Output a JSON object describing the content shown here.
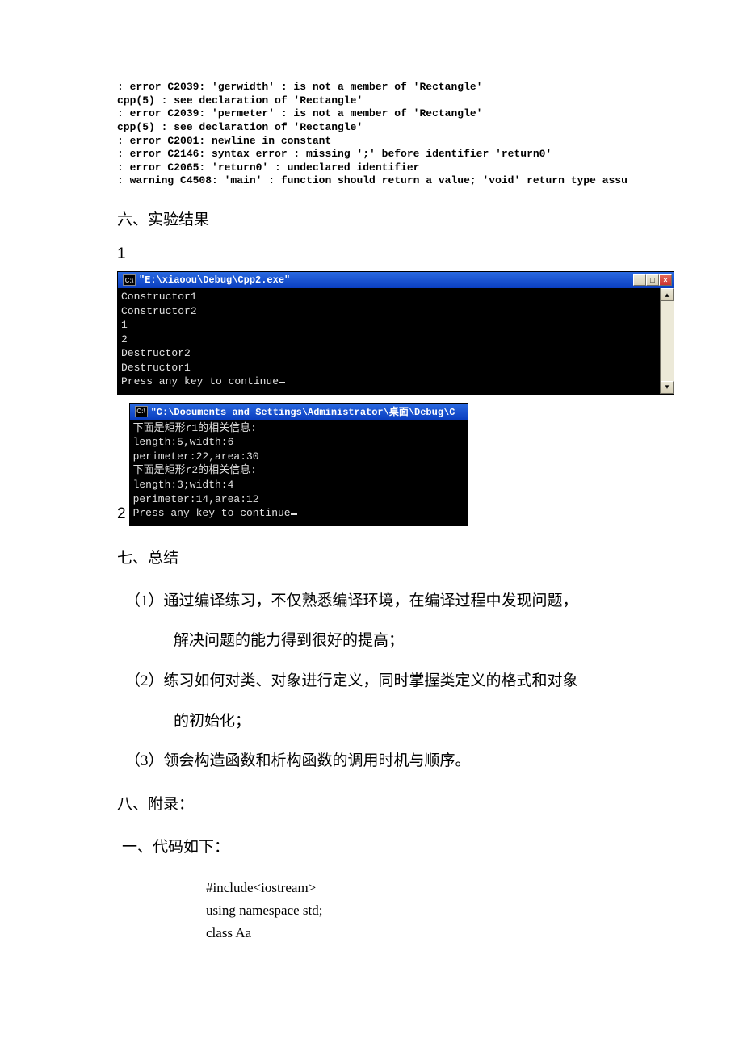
{
  "compiler_errors": [
    ": error C2039: 'gerwidth' : is not a member of 'Rectangle'",
    "cpp(5) : see declaration of 'Rectangle'",
    ": error C2039: 'permeter' : is not a member of 'Rectangle'",
    "cpp(5) : see declaration of 'Rectangle'",
    ": error C2001: newline in constant",
    ": error C2146: syntax error : missing ';' before identifier 'return0'",
    ": error C2065: 'return0' : undeclared identifier",
    ": warning C4508: 'main' : function should return a value; 'void' return type assu"
  ],
  "headings": {
    "six": "六、实验结果",
    "seven": "七、总结",
    "eight": "八、附录：",
    "code_sub": "一、代码如下："
  },
  "labels": {
    "num1": "1",
    "num2": "2",
    "cmd_icon": "C:\\"
  },
  "win1": {
    "title": "\"E:\\xiaoou\\Debug\\Cpp2.exe\"",
    "lines": [
      "Constructor1",
      "Constructor2",
      "1",
      "2",
      "Destructor2",
      "Destructor1",
      "Press any key to continue"
    ],
    "btn_min": "_",
    "btn_max": "□",
    "btn_close": "×",
    "arr_up": "▴",
    "arr_dn": "▾"
  },
  "win2": {
    "title": "\"C:\\Documents and Settings\\Administrator\\桌面\\Debug\\C",
    "lines": [
      "下面是矩形r1的相关信息:",
      "length:5,width:6",
      "perimeter:22,area:30",
      "下面是矩形r2的相关信息:",
      "length:3;width:4",
      "perimeter:14,area:12",
      "Press any key to continue"
    ]
  },
  "summary": {
    "p1": "（1）通过编译练习，不仅熟悉编译环境，在编译过程中发现问题，",
    "p1b": "解决问题的能力得到很好的提高；",
    "p2": "（2）练习如何对类、对象进行定义，同时掌握类定义的格式和对象",
    "p2b": "的初始化；",
    "p3": "（3）领会构造函数和析构函数的调用时机与顺序。"
  },
  "code": {
    "l1": "#include<iostream>",
    "l2": "using namespace std;",
    "l3": "class Aa"
  }
}
